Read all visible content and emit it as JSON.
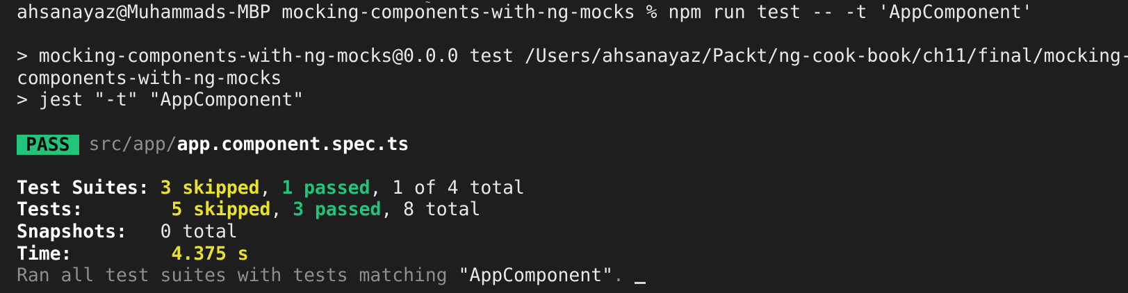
{
  "prompt": {
    "user_host": "ahsanayaz@Muhammads-MBP",
    "directory": "mocking-components-with-ng-mocks",
    "symbol": "%",
    "command": "npm run test -- -t 'AppComponent'"
  },
  "npm_output": {
    "script_line_1": "> mocking-components-with-ng-mocks@0.0.0 test /Users/ahsanayaz/Packt/ng-cook-book/ch11/final/mocking-",
    "script_line_2": "components-with-ng-mocks",
    "script_line_3": "> jest \"-t\" \"AppComponent\""
  },
  "result": {
    "status": "PASS",
    "file_dir": "src/app/",
    "file_name": "app.component.spec.ts"
  },
  "summary": {
    "suites": {
      "label": "Test Suites:",
      "skipped": "3 skipped",
      "passed": "1 passed",
      "rest": "1 of 4 total"
    },
    "tests": {
      "label": "Tests:",
      "skipped": "5 skipped",
      "passed": "3 passed",
      "rest": "8 total"
    },
    "snapshots": {
      "label": "Snapshots:",
      "value": "0 total"
    },
    "time": {
      "label": "Time:",
      "value": "4.375 s"
    },
    "footer_prefix": "Ran all test suites with tests matching ",
    "footer_pattern": "\"AppComponent\"",
    "footer_suffix": "."
  },
  "colors": {
    "background": "#1e1e1e",
    "text": "#e8e8e8",
    "yellow": "#e8e22a",
    "green": "#21c47a",
    "dim": "#8e8e8e"
  }
}
